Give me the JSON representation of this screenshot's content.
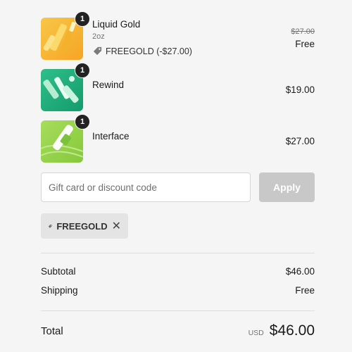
{
  "items": [
    {
      "name": "Liquid Gold",
      "variant": "2oz",
      "quantity": "1",
      "discount": "FREEGOLD (-$27.00)",
      "original_price": "$27.00",
      "price": "Free"
    },
    {
      "name": "Rewind",
      "quantity": "1",
      "price": "$19.00"
    },
    {
      "name": "Interface",
      "quantity": "1",
      "price": "$27.00"
    }
  ],
  "discount_form": {
    "placeholder": "Gift card or discount code",
    "apply_label": "Apply"
  },
  "applied_code": {
    "code": "FREEGOLD"
  },
  "summary": {
    "subtotal_label": "Subtotal",
    "subtotal_value": "$46.00",
    "shipping_label": "Shipping",
    "shipping_value": "Free",
    "total_label": "Total",
    "currency": "USD",
    "total_value": "$46.00"
  },
  "colors": {
    "accent_button": "#c8c8c8",
    "badge": "#222222"
  }
}
